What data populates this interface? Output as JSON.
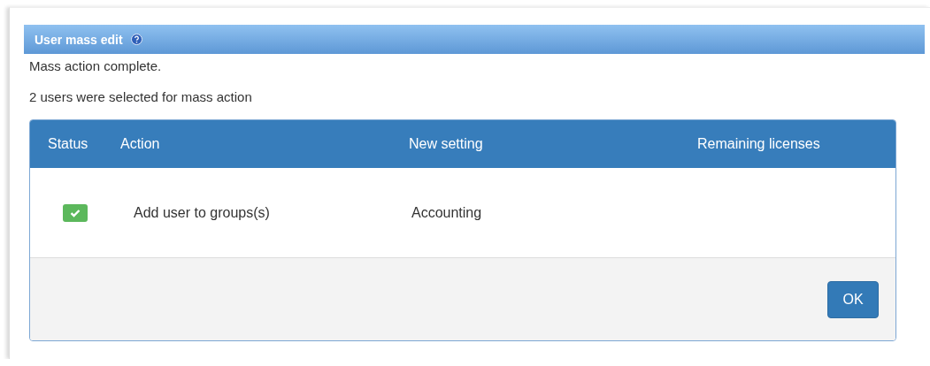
{
  "panel": {
    "title": "User mass edit"
  },
  "messages": [
    "Mass action complete.",
    "2 users were selected for mass action"
  ],
  "table": {
    "columns": [
      "Status",
      "Action",
      "New setting",
      "Remaining licenses"
    ],
    "rows": [
      {
        "success": true,
        "action": "Add user to groups(s)",
        "new_setting": "Accounting"
      }
    ]
  },
  "buttons": [
    "OK"
  ]
}
